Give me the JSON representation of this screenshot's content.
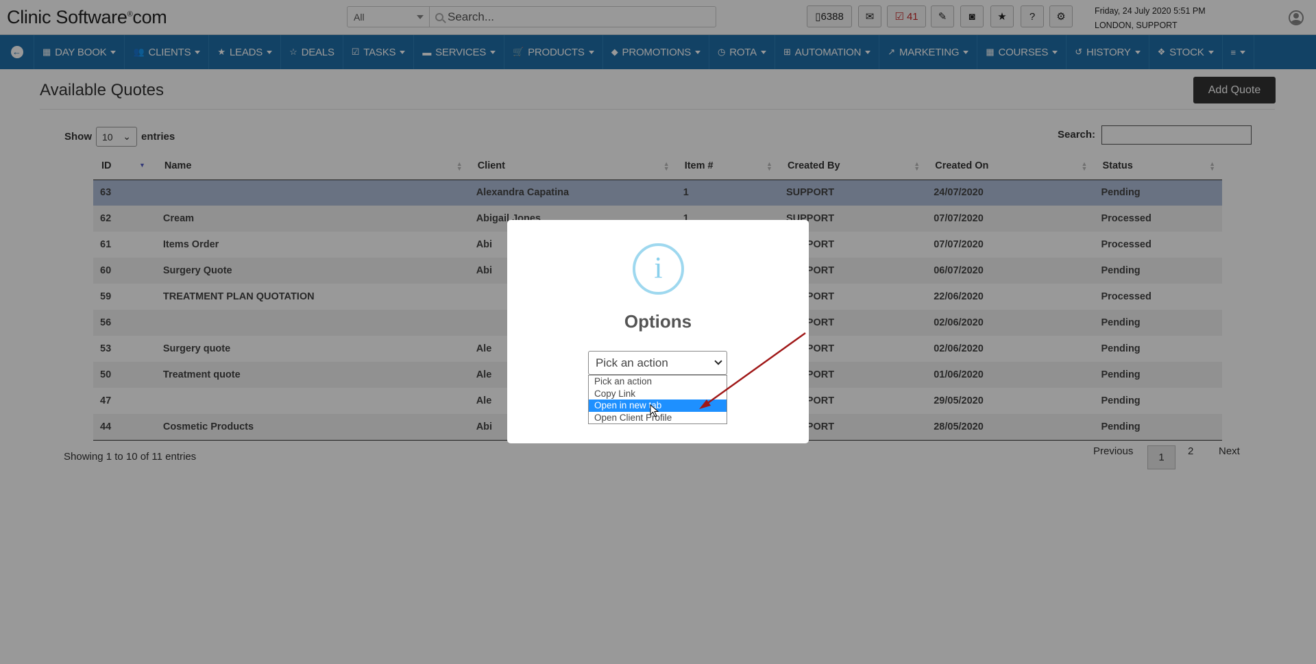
{
  "brand": {
    "name": "Clinic Software",
    "sup": "®",
    "suffix": "com"
  },
  "search": {
    "scope": "All",
    "placeholder": "Search..."
  },
  "toolbar": {
    "sms_count": "6388",
    "tasks_count": "41"
  },
  "datetime": {
    "line1": "Friday, 24 July 2020  5:51 PM",
    "line2": "LONDON, SUPPORT"
  },
  "nav": [
    {
      "label": "DAY BOOK",
      "icon": "calendar-icon",
      "glyph": "▦"
    },
    {
      "label": "CLIENTS",
      "icon": "users-icon",
      "glyph": "👥"
    },
    {
      "label": "LEADS",
      "icon": "star-icon",
      "glyph": "★"
    },
    {
      "label": "DEALS",
      "icon": "star-half-icon",
      "glyph": "☆"
    },
    {
      "label": "TASKS",
      "icon": "check-square-icon",
      "glyph": "☑"
    },
    {
      "label": "SERVICES",
      "icon": "briefcase-icon",
      "glyph": "▬"
    },
    {
      "label": "PRODUCTS",
      "icon": "cart-icon",
      "glyph": "🛒"
    },
    {
      "label": "PROMOTIONS",
      "icon": "tag-icon",
      "glyph": "◆"
    },
    {
      "label": "ROTA",
      "icon": "clock-icon",
      "glyph": "◷"
    },
    {
      "label": "AUTOMATION",
      "icon": "sitemap-icon",
      "glyph": "⊞"
    },
    {
      "label": "MARKETING",
      "icon": "chart-line-icon",
      "glyph": "↗"
    },
    {
      "label": "COURSES",
      "icon": "grid-icon",
      "glyph": "▦"
    },
    {
      "label": "HISTORY",
      "icon": "history-icon",
      "glyph": "↺"
    },
    {
      "label": "STOCK",
      "icon": "cubes-icon",
      "glyph": "❖"
    }
  ],
  "page": {
    "title": "Available Quotes",
    "add_label": "Add Quote",
    "show_label": "Show",
    "entries_label": "entries",
    "page_size": "10",
    "search_label": "Search:",
    "info": "Showing 1 to 10 of 11 entries",
    "prev": "Previous",
    "pages": [
      "1",
      "2"
    ],
    "next": "Next"
  },
  "table": {
    "columns": [
      "ID",
      "Name",
      "Client",
      "Item #",
      "Created By",
      "Created On",
      "Status"
    ],
    "rows": [
      {
        "id": "63",
        "name": "",
        "client": "Alexandra Capatina",
        "items": "1",
        "by": "SUPPORT",
        "on": "24/07/2020",
        "status": "Pending"
      },
      {
        "id": "62",
        "name": "Cream",
        "client": "Abigail Jones",
        "items": "1",
        "by": "SUPPORT",
        "on": "07/07/2020",
        "status": "Processed"
      },
      {
        "id": "61",
        "name": "Items Order",
        "client": "Abi",
        "items": "",
        "by": "SUPPORT",
        "on": "07/07/2020",
        "status": "Processed"
      },
      {
        "id": "60",
        "name": "Surgery Quote",
        "client": "Abi",
        "items": "",
        "by": "SUPPORT",
        "on": "06/07/2020",
        "status": "Pending"
      },
      {
        "id": "59",
        "name": "TREATMENT PLAN QUOTATION",
        "client": "",
        "items": "",
        "by": "SUPPORT",
        "on": "22/06/2020",
        "status": "Processed"
      },
      {
        "id": "56",
        "name": "",
        "client": "",
        "items": "",
        "by": "SUPPORT",
        "on": "02/06/2020",
        "status": "Pending"
      },
      {
        "id": "53",
        "name": "Surgery quote",
        "client": "Ale",
        "items": "",
        "by": "SUPPORT",
        "on": "02/06/2020",
        "status": "Pending"
      },
      {
        "id": "50",
        "name": "Treatment quote",
        "client": "Ale",
        "items": "",
        "by": "SUPPORT",
        "on": "01/06/2020",
        "status": "Pending"
      },
      {
        "id": "47",
        "name": "",
        "client": "Ale",
        "items": "",
        "by": "SUPPORT",
        "on": "29/05/2020",
        "status": "Pending"
      },
      {
        "id": "44",
        "name": "Cosmetic Products",
        "client": "Abi",
        "items": "",
        "by": "SUPPORT",
        "on": "28/05/2020",
        "status": "Pending"
      }
    ]
  },
  "modal": {
    "icon": "info-icon",
    "title": "Options",
    "select_value": "Pick an action",
    "options": [
      "Pick an action",
      "Copy Link",
      "Open in new tab",
      "Open Client Profile"
    ],
    "highlighted": "Open in new tab"
  },
  "colors": {
    "nav": "#1f6fa8",
    "processed": "#1e8a1e",
    "highlight": "#1e90ff",
    "arrow": "#a01818"
  }
}
